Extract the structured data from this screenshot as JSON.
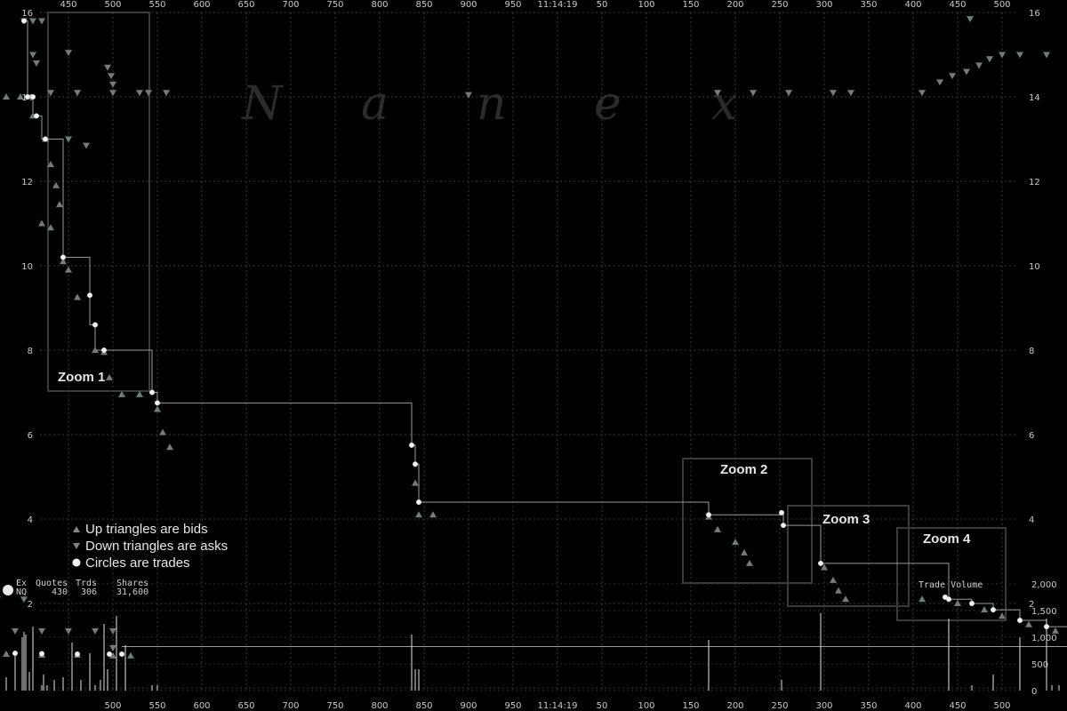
{
  "watermark": [
    "N",
    "a",
    "n",
    "e",
    "x"
  ],
  "time_label": "11:14:19",
  "chart_data": {
    "type": "scatter",
    "title": "",
    "top_axis_labels": [
      "450",
      "500",
      "550",
      "600",
      "650",
      "700",
      "750",
      "800",
      "850",
      "900",
      "950",
      "11:14:19",
      "50",
      "100",
      "150",
      "200",
      "250",
      "300",
      "350",
      "400",
      "450",
      "500"
    ],
    "bottom_axis_labels": [
      "500",
      "550",
      "600",
      "650",
      "700",
      "750",
      "800",
      "850",
      "900",
      "950",
      "11:14:19",
      "50",
      "100",
      "150",
      "200",
      "250",
      "300",
      "350",
      "400",
      "450",
      "500"
    ],
    "price_axis": {
      "min": 0,
      "max": 16,
      "ticks": [
        "2",
        "4",
        "6",
        "8",
        "10",
        "12",
        "14",
        "16"
      ]
    },
    "volume_axis": {
      "ticks": [
        "0",
        "500",
        "1,000",
        "1,500",
        "2,000"
      ],
      "label": "Trade Volume"
    },
    "legend": [
      {
        "marker": "up-triangle",
        "text": "Up triangles are bids"
      },
      {
        "marker": "down-triangle",
        "text": "Down triangles are asks"
      },
      {
        "marker": "circle",
        "text": "Circles are trades"
      }
    ],
    "zoom_boxes": [
      {
        "label": "Zoom 1"
      },
      {
        "label": "Zoom 2"
      },
      {
        "label": "Zoom 3"
      },
      {
        "label": "Zoom 4"
      }
    ],
    "stats": {
      "headers": [
        "Ex",
        "Quotes",
        "Trds",
        "Shares"
      ],
      "row": [
        "NQ",
        "430",
        "306",
        "31,600"
      ]
    },
    "trades": [
      {
        "t": 450,
        "p": 15.8
      },
      {
        "t": 452,
        "p": 14.0
      },
      {
        "t": 455,
        "p": 14.0
      },
      {
        "t": 457,
        "p": 13.55
      },
      {
        "t": 462,
        "p": 13.0
      },
      {
        "t": 472,
        "p": 10.2
      },
      {
        "t": 487,
        "p": 9.3
      },
      {
        "t": 490,
        "p": 8.6
      },
      {
        "t": 495,
        "p": 8.0
      },
      {
        "t": 522,
        "p": 7.0
      },
      {
        "t": 525,
        "p": 6.75
      },
      {
        "t": 668,
        "p": 5.75
      },
      {
        "t": 670,
        "p": 5.3
      },
      {
        "t": 672,
        "p": 4.4
      },
      {
        "t": 835,
        "p": 4.1
      },
      {
        "t": 876,
        "p": 4.15
      },
      {
        "t": 877,
        "p": 3.85
      },
      {
        "t": 898,
        "p": 2.95
      },
      {
        "t": 168,
        "p": 2.15
      },
      {
        "t": 170,
        "p": 2.1
      },
      {
        "t": 183,
        "p": 2.0
      },
      {
        "t": 195,
        "p": 1.85
      },
      {
        "t": 210,
        "p": 1.6
      },
      {
        "t": 225,
        "p": 1.45
      },
      {
        "t": 270,
        "p": 1.3
      },
      {
        "t": 283,
        "p": 1.15
      },
      {
        "t": 302,
        "p": 1.15
      },
      {
        "t": 320,
        "p": 1.08
      },
      {
        "t": 345,
        "p": 0.98
      },
      {
        "t": 357,
        "p": 0.95
      },
      {
        "t": 370,
        "p": 0.93
      },
      {
        "t": 385,
        "p": 0.9
      },
      {
        "t": 395,
        "p": 0.88
      },
      {
        "t": 410,
        "p": 0.85
      },
      {
        "t": 425,
        "p": 0.83
      },
      {
        "t": 445,
        "p": 0.82
      },
      {
        "t": 460,
        "p": 0.81
      },
      {
        "t": 480,
        "p": 0.8
      },
      {
        "t": 498,
        "p": 0.8
      },
      {
        "t": 505,
        "p": 0.8
      }
    ],
    "bids": [
      {
        "t": 440,
        "p": 14.0
      },
      {
        "t": 448,
        "p": 14.0
      },
      {
        "t": 455,
        "p": 13.55
      },
      {
        "t": 462,
        "p": 13.0
      },
      {
        "t": 465,
        "p": 12.4
      },
      {
        "t": 468,
        "p": 11.9
      },
      {
        "t": 470,
        "p": 11.45
      },
      {
        "t": 460,
        "p": 11.0
      },
      {
        "t": 465,
        "p": 10.9
      },
      {
        "t": 472,
        "p": 10.1
      },
      {
        "t": 475,
        "p": 9.9
      },
      {
        "t": 480,
        "p": 9.25
      },
      {
        "t": 490,
        "p": 8.0
      },
      {
        "t": 495,
        "p": 7.95
      },
      {
        "t": 498,
        "p": 7.35
      },
      {
        "t": 505,
        "p": 6.95
      },
      {
        "t": 515,
        "p": 6.95
      },
      {
        "t": 525,
        "p": 6.6
      },
      {
        "t": 528,
        "p": 6.05
      },
      {
        "t": 532,
        "p": 5.7
      },
      {
        "t": 670,
        "p": 4.85
      },
      {
        "t": 672,
        "p": 4.1
      },
      {
        "t": 680,
        "p": 4.1
      },
      {
        "t": 835,
        "p": 4.05
      },
      {
        "t": 840,
        "p": 3.75
      },
      {
        "t": 850,
        "p": 3.45
      },
      {
        "t": 855,
        "p": 3.2
      },
      {
        "t": 858,
        "p": 2.95
      },
      {
        "t": 900,
        "p": 2.85
      },
      {
        "t": 905,
        "p": 2.55
      },
      {
        "t": 908,
        "p": 2.3
      },
      {
        "t": 912,
        "p": 2.1
      },
      {
        "t": 155,
        "p": 2.1
      },
      {
        "t": 175,
        "p": 2.0
      },
      {
        "t": 190,
        "p": 1.85
      },
      {
        "t": 200,
        "p": 1.7
      },
      {
        "t": 215,
        "p": 1.5
      },
      {
        "t": 230,
        "p": 1.35
      },
      {
        "t": 245,
        "p": 1.3
      },
      {
        "t": 255,
        "p": 1.15
      },
      {
        "t": 275,
        "p": 1.1
      },
      {
        "t": 290,
        "p": 1.1
      },
      {
        "t": 310,
        "p": 1.05
      },
      {
        "t": 330,
        "p": 1.0
      },
      {
        "t": 340,
        "p": 0.9
      },
      {
        "t": 360,
        "p": 0.88
      },
      {
        "t": 380,
        "p": 0.85
      },
      {
        "t": 400,
        "p": 0.83
      },
      {
        "t": 420,
        "p": 0.8
      },
      {
        "t": 440,
        "p": 0.8
      },
      {
        "t": 460,
        "p": 0.78
      },
      {
        "t": 480,
        "p": 0.78
      },
      {
        "t": 500,
        "p": 0.76
      },
      {
        "t": 510,
        "p": 0.76
      }
    ],
    "asks": [
      {
        "t": 450,
        "p": 15.8
      },
      {
        "t": 455,
        "p": 15.8
      },
      {
        "t": 460,
        "p": 15.8
      },
      {
        "t": 455,
        "p": 15.0
      },
      {
        "t": 457,
        "p": 14.8
      },
      {
        "t": 475,
        "p": 15.05
      },
      {
        "t": 465,
        "p": 14.1
      },
      {
        "t": 480,
        "p": 14.1
      },
      {
        "t": 500,
        "p": 14.1
      },
      {
        "t": 515,
        "p": 14.1
      },
      {
        "t": 520,
        "p": 14.1
      },
      {
        "t": 530,
        "p": 14.1
      },
      {
        "t": 497,
        "p": 14.7
      },
      {
        "t": 499,
        "p": 14.5
      },
      {
        "t": 500,
        "p": 14.3
      },
      {
        "t": 475,
        "p": 13.0
      },
      {
        "t": 485,
        "p": 12.85
      },
      {
        "t": 700,
        "p": 14.05
      },
      {
        "t": 840,
        "p": 14.1
      },
      {
        "t": 860,
        "p": 14.1
      },
      {
        "t": 880,
        "p": 14.1
      },
      {
        "t": 905,
        "p": 14.1
      },
      {
        "t": 915,
        "p": 14.1
      },
      {
        "t": 155,
        "p": 14.1
      },
      {
        "t": 165,
        "p": 14.35
      },
      {
        "t": 172,
        "p": 14.5
      },
      {
        "t": 180,
        "p": 14.6
      },
      {
        "t": 187,
        "p": 14.75
      },
      {
        "t": 193,
        "p": 14.9
      },
      {
        "t": 200,
        "p": 15.0
      },
      {
        "t": 210,
        "p": 15.0
      },
      {
        "t": 225,
        "p": 15.0
      },
      {
        "t": 240,
        "p": 15.0
      },
      {
        "t": 252,
        "p": 15.0
      },
      {
        "t": 262,
        "p": 15.0
      },
      {
        "t": 182,
        "p": 15.85
      },
      {
        "t": 245,
        "p": 11.55
      },
      {
        "t": 258,
        "p": 11.55
      },
      {
        "t": 275,
        "p": 11.55
      },
      {
        "t": 288,
        "p": 11.75
      },
      {
        "t": 290,
        "p": 7.7
      },
      {
        "t": 305,
        "p": 7.7
      },
      {
        "t": 320,
        "p": 7.7
      },
      {
        "t": 340,
        "p": 7.7
      },
      {
        "t": 345,
        "p": 7.8
      },
      {
        "t": 340,
        "p": 4.35
      },
      {
        "t": 355,
        "p": 4.35
      },
      {
        "t": 370,
        "p": 4.35
      },
      {
        "t": 385,
        "p": 4.35
      },
      {
        "t": 395,
        "p": 4.4
      },
      {
        "t": 405,
        "p": 2.1
      },
      {
        "t": 420,
        "p": 2.1
      },
      {
        "t": 435,
        "p": 2.1
      },
      {
        "t": 450,
        "p": 2.1
      },
      {
        "t": 445,
        "p": 1.35
      },
      {
        "t": 460,
        "p": 1.35
      },
      {
        "t": 475,
        "p": 1.35
      },
      {
        "t": 490,
        "p": 1.35
      },
      {
        "t": 500,
        "p": 1.35
      },
      {
        "t": 500,
        "p": 0.95
      }
    ],
    "trade_path": [
      {
        "t": 450,
        "p": 15.8
      },
      {
        "t": 452,
        "p": 15.8
      },
      {
        "t": 452,
        "p": 14.0
      },
      {
        "t": 455,
        "p": 14.0
      },
      {
        "t": 455,
        "p": 13.55
      },
      {
        "t": 460,
        "p": 13.55
      },
      {
        "t": 460,
        "p": 13.0
      },
      {
        "t": 472,
        "p": 13.0
      },
      {
        "t": 472,
        "p": 10.2
      },
      {
        "t": 487,
        "p": 10.2
      },
      {
        "t": 487,
        "p": 9.3
      },
      {
        "t": 487,
        "p": 8.6
      },
      {
        "t": 490,
        "p": 8.6
      },
      {
        "t": 490,
        "p": 8.0
      },
      {
        "t": 522,
        "p": 8.0
      },
      {
        "t": 522,
        "p": 7.0
      },
      {
        "t": 525,
        "p": 7.0
      },
      {
        "t": 525,
        "p": 6.75
      },
      {
        "t": 668,
        "p": 6.75
      },
      {
        "t": 668,
        "p": 5.75
      },
      {
        "t": 670,
        "p": 5.75
      },
      {
        "t": 670,
        "p": 5.3
      },
      {
        "t": 672,
        "p": 5.3
      },
      {
        "t": 672,
        "p": 4.4
      },
      {
        "t": 835,
        "p": 4.4
      },
      {
        "t": 835,
        "p": 4.1
      },
      {
        "t": 876,
        "p": 4.1
      },
      {
        "t": 876,
        "p": 4.15
      },
      {
        "t": 877,
        "p": 4.15
      },
      {
        "t": 877,
        "p": 3.85
      },
      {
        "t": 898,
        "p": 3.85
      },
      {
        "t": 898,
        "p": 2.95
      },
      {
        "t": 170,
        "p": 2.95
      },
      {
        "t": 170,
        "p": 2.1
      },
      {
        "t": 183,
        "p": 2.1
      },
      {
        "t": 183,
        "p": 2.0
      },
      {
        "t": 195,
        "p": 2.0
      },
      {
        "t": 195,
        "p": 1.85
      },
      {
        "t": 210,
        "p": 1.85
      },
      {
        "t": 210,
        "p": 1.6
      },
      {
        "t": 225,
        "p": 1.6
      },
      {
        "t": 225,
        "p": 1.45
      },
      {
        "t": 270,
        "p": 1.45
      },
      {
        "t": 270,
        "p": 1.3
      },
      {
        "t": 283,
        "p": 1.3
      },
      {
        "t": 283,
        "p": 1.15
      },
      {
        "t": 320,
        "p": 1.15
      },
      {
        "t": 320,
        "p": 1.08
      },
      {
        "t": 345,
        "p": 1.08
      },
      {
        "t": 345,
        "p": 0.98
      },
      {
        "t": 505,
        "p": 0.98
      }
    ],
    "volume": [
      {
        "t": 449,
        "v": 1000
      },
      {
        "t": 451,
        "v": 1050
      },
      {
        "t": 453,
        "v": 350
      },
      {
        "t": 455,
        "v": 350
      },
      {
        "t": 460,
        "v": 100
      },
      {
        "t": 463,
        "v": 100
      },
      {
        "t": 472,
        "v": 100
      },
      {
        "t": 487,
        "v": 100
      },
      {
        "t": 490,
        "v": 100
      },
      {
        "t": 495,
        "v": 1250
      },
      {
        "t": 522,
        "v": 100
      },
      {
        "t": 525,
        "v": 100
      },
      {
        "t": 668,
        "v": 1050
      },
      {
        "t": 670,
        "v": 400
      },
      {
        "t": 672,
        "v": 400
      },
      {
        "t": 835,
        "v": 950
      },
      {
        "t": 876,
        "v": 200
      },
      {
        "t": 898,
        "v": 1450
      },
      {
        "t": 170,
        "v": 1350
      },
      {
        "t": 183,
        "v": 100
      },
      {
        "t": 195,
        "v": 300
      },
      {
        "t": 210,
        "v": 1000
      },
      {
        "t": 225,
        "v": 1350
      },
      {
        "t": 228,
        "v": 100
      },
      {
        "t": 232,
        "v": 100
      },
      {
        "t": 245,
        "v": 100
      },
      {
        "t": 255,
        "v": 200
      },
      {
        "t": 270,
        "v": 200
      },
      {
        "t": 283,
        "v": 100
      },
      {
        "t": 303,
        "v": 1500
      },
      {
        "t": 308,
        "v": 200
      },
      {
        "t": 322,
        "v": 1300
      },
      {
        "t": 332,
        "v": 550
      },
      {
        "t": 342,
        "v": 1650
      },
      {
        "t": 350,
        "v": 450
      },
      {
        "t": 360,
        "v": 200
      },
      {
        "t": 368,
        "v": 1450
      },
      {
        "t": 375,
        "v": 450
      },
      {
        "t": 383,
        "v": 200
      },
      {
        "t": 388,
        "v": 900
      },
      {
        "t": 396,
        "v": 450
      },
      {
        "t": 405,
        "v": 700
      },
      {
        "t": 410,
        "v": 900
      },
      {
        "t": 415,
        "v": 250
      },
      {
        "t": 422,
        "v": 200
      },
      {
        "t": 427,
        "v": 850
      },
      {
        "t": 433,
        "v": 950
      },
      {
        "t": 440,
        "v": 250
      },
      {
        "t": 445,
        "v": 650
      },
      {
        "t": 450,
        "v": 1100
      },
      {
        "t": 455,
        "v": 1200
      },
      {
        "t": 461,
        "v": 300
      },
      {
        "t": 467,
        "v": 200
      },
      {
        "t": 472,
        "v": 250
      },
      {
        "t": 477,
        "v": 900
      },
      {
        "t": 482,
        "v": 200
      },
      {
        "t": 487,
        "v": 700
      },
      {
        "t": 493,
        "v": 200
      },
      {
        "t": 497,
        "v": 400
      },
      {
        "t": 502,
        "v": 1400
      },
      {
        "t": 507,
        "v": 850
      }
    ]
  }
}
